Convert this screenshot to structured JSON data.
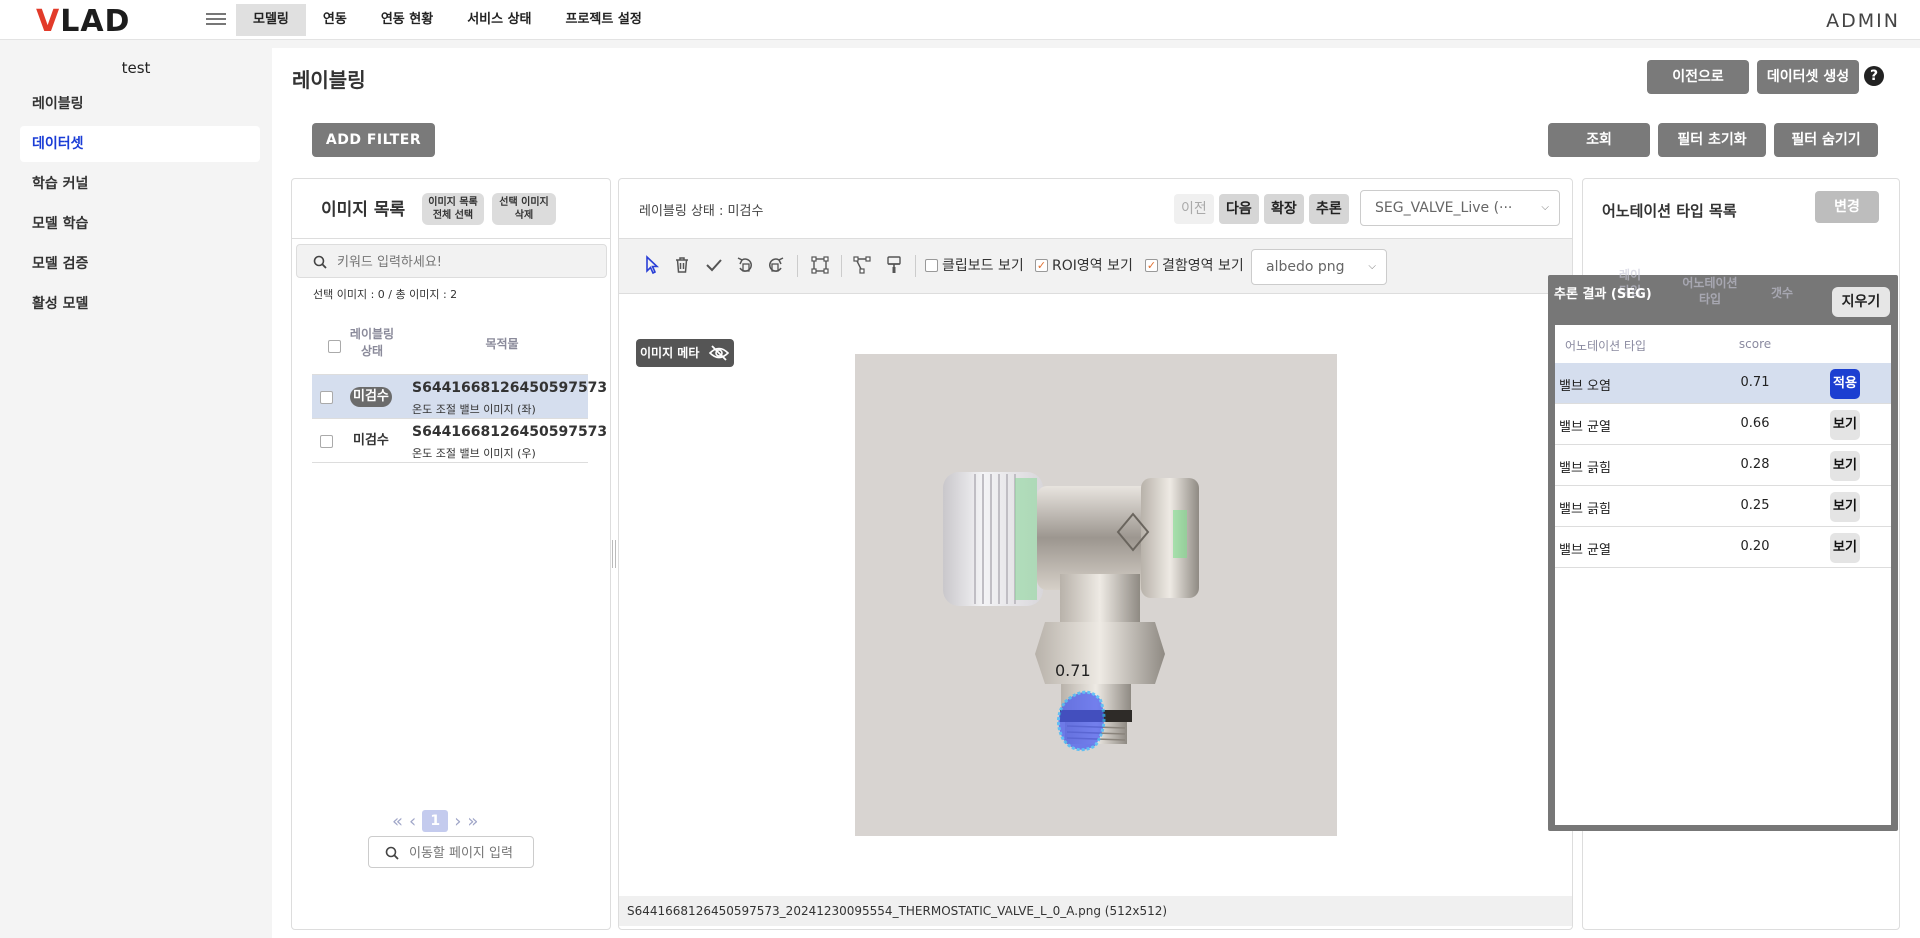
{
  "header": {
    "logo": "VLAD",
    "nav": [
      "모델링",
      "연동",
      "연동 현황",
      "서비스 상태",
      "프로젝트 설정"
    ],
    "user": "ADMIN"
  },
  "sidebar": {
    "project": "test",
    "items": [
      "레이블링",
      "데이터셋",
      "학습 커널",
      "모델 학습",
      "모델 검증",
      "활성 모델"
    ]
  },
  "page": {
    "title": "레이블링",
    "back_button": "이전으로",
    "create_dataset_button": "데이터셋 생성",
    "help": "?",
    "add_filter": "ADD FILTER",
    "search_button": "조회",
    "reset_filter": "필터 초기화",
    "hide_filter": "필터 숨기기"
  },
  "image_list": {
    "title": "이미지 목록",
    "select_all_line1": "이미지 목록",
    "select_all_line2": "전체 선택",
    "delete_line1": "선택 이미지",
    "delete_line2": "삭제",
    "search_placeholder": "키워드 입력하세요!",
    "count": "선택 이미지 : 0 / 총 이미지 : 2",
    "col_status_line1": "레이블링",
    "col_status_line2": "상태",
    "col_object": "목적물",
    "rows": [
      {
        "status": "미검수",
        "id": "S6441668126450597573",
        "desc": "온도 조절 밸브 이미지 (좌)"
      },
      {
        "status": "미검수",
        "id": "S6441668126450597573",
        "desc": "온도 조절 밸브 이미지 (우)"
      }
    ],
    "page": "1",
    "page_input_placeholder": "이동할 페이지 입력"
  },
  "viewer": {
    "status": "레이블링 상태 : 미검수",
    "prev": "이전",
    "next": "다음",
    "expand": "확장",
    "infer": "추론",
    "model_select": "SEG_VALVE_Live (···",
    "clipboard": "클립보드 보기",
    "roi": "ROI영역 보기",
    "defect": "결함영역 보기",
    "image_type": "albedo png",
    "meta_tag": "이미지 메타",
    "score_label": "0.71",
    "filename": "S6441668126450597573_20241230095554_THERMOSTATIC_VALVE_L_0_A.png",
    "dimensions": "(512x512)"
  },
  "annotation_types": {
    "title": "어노테이션 타입 목록",
    "change": "변경",
    "col_label_line1": "레이",
    "col_label_line2": "타입",
    "col_anno_line1": "어노테이션",
    "col_anno_line2": "타입",
    "col_count": "갯수"
  },
  "inference": {
    "title": "추론 결과 (SEG)",
    "clear": "지우기",
    "col_type": "어노테이션 타입",
    "col_score": "score",
    "rows": [
      {
        "name": "밸브 오염",
        "score": "0.71",
        "action": "적용"
      },
      {
        "name": "밸브 균열",
        "score": "0.66",
        "action": "보기"
      },
      {
        "name": "밸브 긁힘",
        "score": "0.28",
        "action": "보기"
      },
      {
        "name": "밸브 긁힘",
        "score": "0.25",
        "action": "보기"
      },
      {
        "name": "밸브 균열",
        "score": "0.20",
        "action": "보기"
      }
    ]
  },
  "colors": {
    "accent_blue": "#1c3fd1",
    "dark_button": "#7a7a7a",
    "selected_row": "#d5deee"
  }
}
